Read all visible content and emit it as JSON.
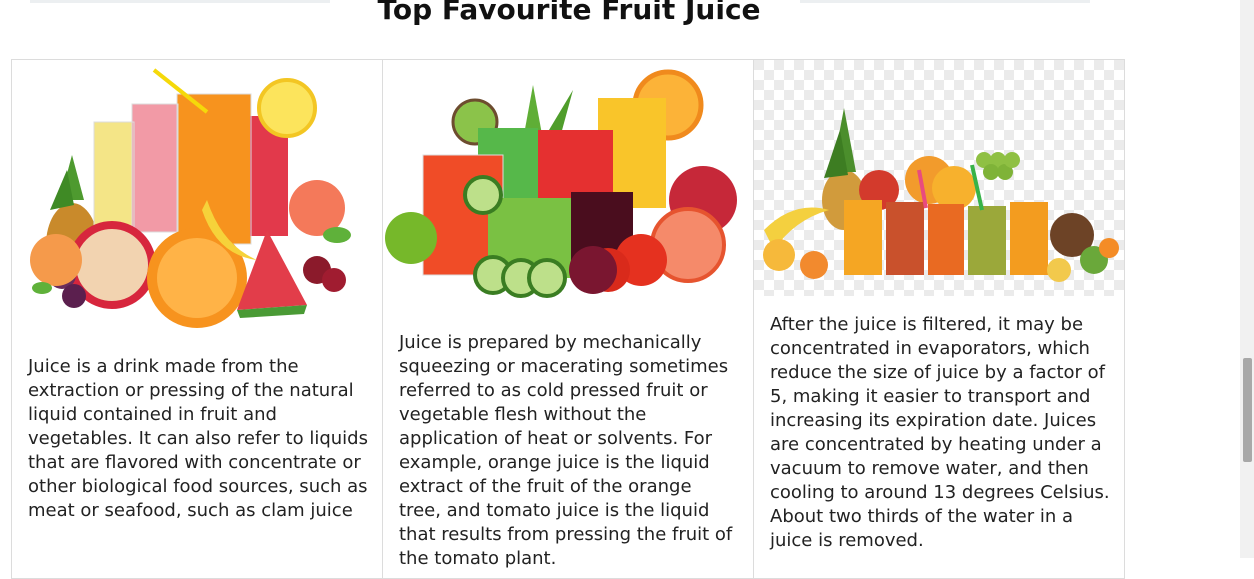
{
  "section": {
    "title": "Top Favourite Fruit Juice"
  },
  "cards": [
    {
      "image": "fruit-juice-glasses-photo",
      "text": "Juice is a drink made from the extraction or pressing of the natural liquid contained in fruit and vegetables. It can also refer to liquids that are flavored with concentrate or other biological food sources, such as meat or seafood, such as clam juice"
    },
    {
      "image": "vegetable-juice-glasses-photo",
      "text": "Juice is prepared by mechanically squeezing or macerating sometimes referred to as cold pressed fruit or vegetable flesh without the application of heat or solvents. For example, orange juice is the liquid extract of the fruit of the orange tree, and tomato juice is the liquid that results from pressing the fruit of the tomato plant."
    },
    {
      "image": "juice-row-with-fruits-photo",
      "text": "After the juice is filtered, it may be concentrated in evaporators, which reduce the size of juice by a factor of 5, making it easier to transport and increasing its expiration date. Juices are concentrated by heating under a vacuum to remove water, and then cooling to around 13 degrees Celsius. About two thirds of the water in a juice is removed."
    }
  ],
  "colors": {
    "heading": "#111111",
    "card_border": "#dcdcdc",
    "orange": "#f7931e",
    "red": "#d7263d",
    "green": "#6bbf3a"
  }
}
